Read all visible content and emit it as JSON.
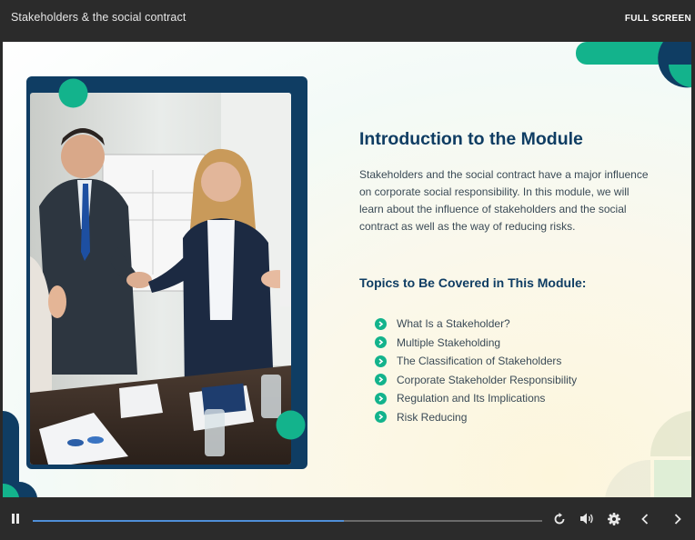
{
  "window": {
    "title": "Stakeholders & the social contract",
    "fullscreen_label": "FULL SCREEN"
  },
  "slide": {
    "heading": "Introduction to the Module",
    "intro": "Stakeholders and the social contract have a major influence on corporate social responsibility. In this module, we will learn about the influence of stakeholders and the social contract as well as the way of reducing risks.",
    "topics_heading": "Topics to Be Covered in This Module:",
    "topics": [
      "What Is a Stakeholder?",
      "Multiple Stakeholding",
      "The Classification of Stakeholders",
      "Corporate Stakeholder Responsibility",
      "Regulation and Its Implications",
      "Risk Reducing"
    ],
    "image": {
      "icon": "business-handshake-photo"
    }
  },
  "player": {
    "progress_fraction": 0.61,
    "icons": [
      "pause-icon",
      "replay-icon",
      "volume-icon",
      "settings-icon",
      "chevron-left-icon",
      "chevron-right-icon"
    ]
  },
  "colors": {
    "accent": "#13b38c",
    "navy": "#0f3d63",
    "bar": "#2b2b2b",
    "progress": "#4f8fd8"
  }
}
